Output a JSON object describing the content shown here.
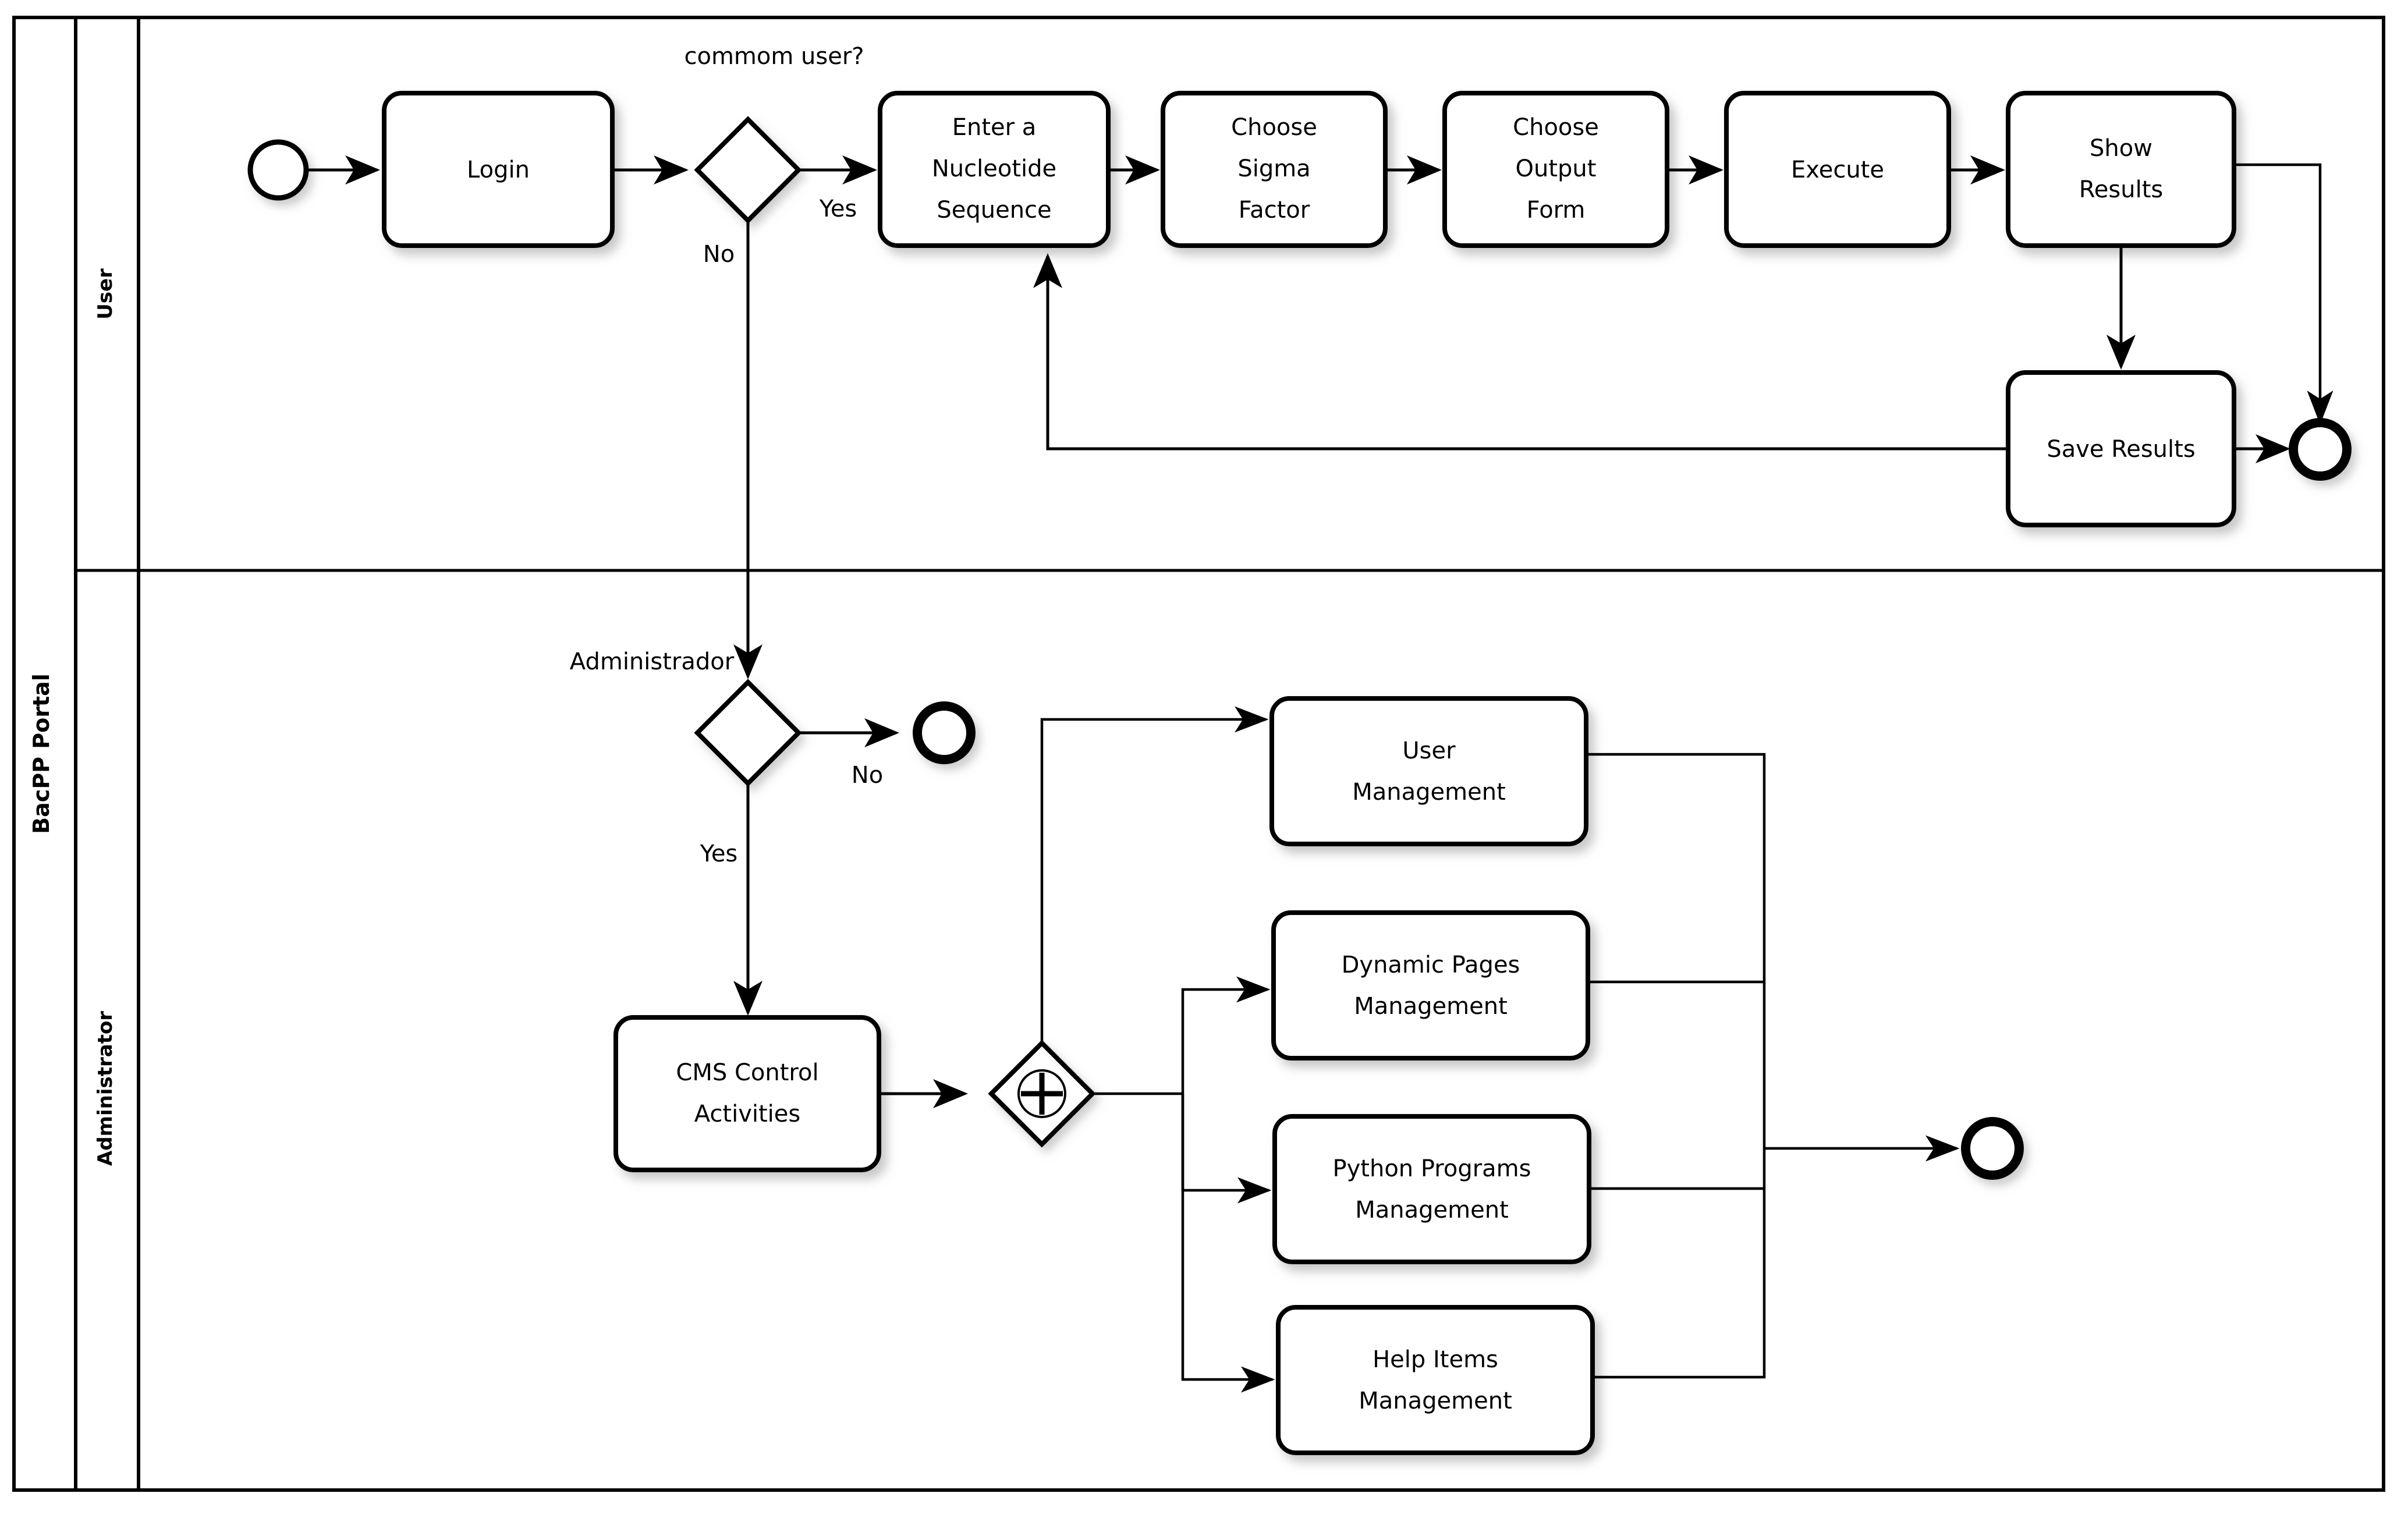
{
  "pool": {
    "name": "BacPP Portal"
  },
  "lanes": [
    {
      "id": "user",
      "name": "User"
    },
    {
      "id": "administrator",
      "name": "Administrator"
    }
  ],
  "user_lane": {
    "start_event": {
      "name": "start-event"
    },
    "tasks": [
      {
        "id": "login",
        "line1": "Login",
        "line2": "",
        "line3": ""
      },
      {
        "id": "enter-nucleotide-sequence",
        "line1": "Enter a",
        "line2": "Nucleotide",
        "line3": "Sequence"
      },
      {
        "id": "choose-sigma-factor",
        "line1": "Choose",
        "line2": "Sigma",
        "line3": "Factor"
      },
      {
        "id": "choose-output-form",
        "line1": "Choose",
        "line2": "Output",
        "line3": "Form"
      },
      {
        "id": "execute",
        "line1": "Execute",
        "line2": "",
        "line3": ""
      },
      {
        "id": "show-results",
        "line1": "Show",
        "line2": "Results",
        "line3": ""
      },
      {
        "id": "save-results",
        "line1": "Save Results",
        "line2": "",
        "line3": ""
      }
    ],
    "gateway": {
      "id": "common-user-gateway",
      "label": "commom user?"
    },
    "flow_labels": {
      "yes": "Yes",
      "no": "No"
    },
    "end_event": {
      "name": "end-event"
    }
  },
  "admin_lane": {
    "gateway": {
      "id": "administrador-gateway",
      "label": "Administrador"
    },
    "flow_labels": {
      "yes": "Yes",
      "no": "No"
    },
    "end_event_no": {
      "name": "end-event-no"
    },
    "tasks": [
      {
        "id": "cms-control-activities",
        "line1": "CMS Control",
        "line2": "Activities"
      },
      {
        "id": "user-management",
        "line1": "User",
        "line2": "Management"
      },
      {
        "id": "dynamic-pages-management",
        "line1": "Dynamic Pages",
        "line2": "Management"
      },
      {
        "id": "python-programs-management",
        "line1": "Python Programs",
        "line2": "Management"
      },
      {
        "id": "help-items-management",
        "line1": "Help Items",
        "line2": "Management"
      }
    ],
    "parallel_gateway": {
      "id": "parallel-split-gateway",
      "symbol": "plus"
    },
    "end_event": {
      "name": "end-event"
    }
  },
  "colors": {
    "stroke": "#000000",
    "fill": "#ffffff",
    "shadow": "#c8c8c8"
  }
}
